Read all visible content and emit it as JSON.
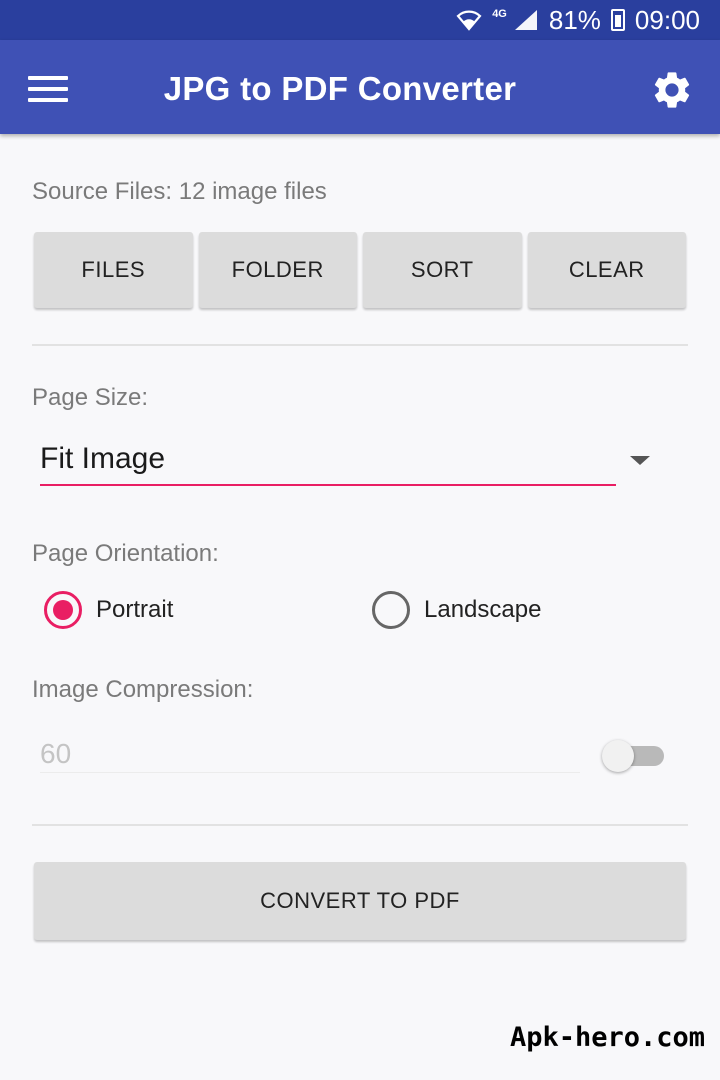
{
  "status_bar": {
    "network": "4G",
    "battery": "81%",
    "time": "09:00",
    "icons": [
      "wifi-icon",
      "signal-icon",
      "battery-icon"
    ]
  },
  "app_bar": {
    "title": "JPG to PDF Converter",
    "icons": [
      "menu-icon",
      "gear-icon"
    ]
  },
  "source": {
    "label": "Source Files: 12 image files",
    "buttons": [
      "FILES",
      "FOLDER",
      "SORT",
      "CLEAR"
    ]
  },
  "page_size": {
    "label": "Page Size:",
    "selected": "Fit Image"
  },
  "orientation": {
    "label": "Page Orientation:",
    "options": [
      "Portrait",
      "Landscape"
    ],
    "selected": "Portrait"
  },
  "compression": {
    "label": "Image Compression:",
    "value": "60",
    "enabled": false
  },
  "convert_label": "CONVERT TO PDF",
  "watermark": "Apk-hero.com",
  "colors": {
    "primary": "#3f51b5",
    "primary_dark": "#2a3f9e",
    "accent": "#e91e63",
    "button": "#dcdcdc"
  }
}
